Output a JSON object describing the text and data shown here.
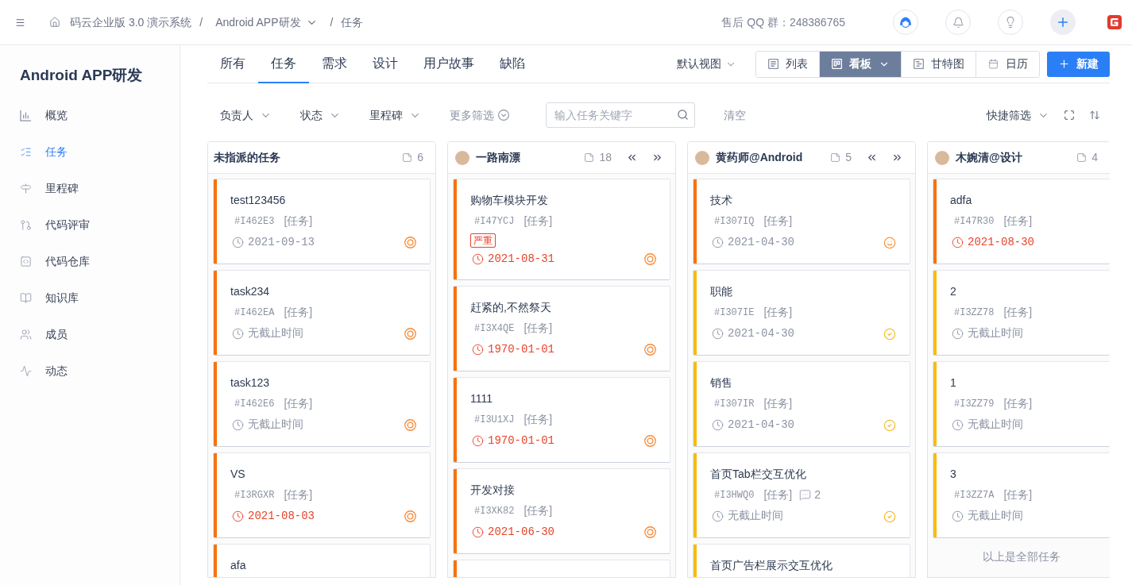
{
  "top_bar": {
    "breadcrumb": [
      {
        "kind": "home",
        "text": "码云企业版 3.0 演示系统"
      },
      {
        "kind": "separator",
        "text": "/"
      },
      {
        "kind": "dropdown",
        "text": "Android APP研发"
      },
      {
        "kind": "separator",
        "text": "/"
      },
      {
        "kind": "current",
        "text": "任务"
      }
    ],
    "support_group": "售后 QQ 群：248386765"
  },
  "sidebar": {
    "title": "Android APP研发",
    "items": [
      {
        "label": "概览",
        "selected": false
      },
      {
        "label": "任务",
        "selected": true
      },
      {
        "label": "里程碑",
        "selected": false
      },
      {
        "label": "代码评审",
        "selected": false
      },
      {
        "label": "代码仓库",
        "selected": false
      },
      {
        "label": "知识库",
        "selected": false
      },
      {
        "label": "成员",
        "selected": false
      },
      {
        "label": "动态",
        "selected": false
      }
    ]
  },
  "tabs": [
    {
      "label": "所有",
      "selected": false
    },
    {
      "label": "任务",
      "selected": true
    },
    {
      "label": "需求",
      "selected": false
    },
    {
      "label": "设计",
      "selected": false
    },
    {
      "label": "用户故事",
      "selected": false
    },
    {
      "label": "缺陷",
      "selected": false
    }
  ],
  "view_picker": {
    "label": "默认视图"
  },
  "view_modes": [
    {
      "label": "列表",
      "selected": false
    },
    {
      "label": "看板",
      "selected": true
    },
    {
      "label": "甘特图",
      "selected": false
    },
    {
      "label": "日历",
      "selected": false
    }
  ],
  "new_button": {
    "label": "新建"
  },
  "filters": [
    {
      "label": "负责人",
      "kind": "dropdown"
    },
    {
      "label": "状态",
      "kind": "dropdown"
    },
    {
      "label": "里程碑",
      "kind": "dropdown"
    },
    {
      "label": "更多筛选",
      "kind": "more"
    }
  ],
  "search": {
    "placeholder": "输入任务关键字"
  },
  "clear_button": {
    "label": "清空"
  },
  "quick_filter": {
    "label": "快捷筛选"
  },
  "columns": [
    {
      "kind": "unassigned",
      "title": "未指派的任务",
      "count": "6",
      "arrows": false,
      "cards": [
        {
          "title": "test123456",
          "number": "#I462E3",
          "type": "[任务]",
          "due": "2021-09-13",
          "overdue": false,
          "color": "#f7720f",
          "status": {
            "kind": "ring"
          }
        },
        {
          "title": "task234",
          "number": "#I462EA",
          "type": "[任务]",
          "due": "无截止时间",
          "overdue": false,
          "color": "#f7720f",
          "status": {
            "kind": "ring"
          }
        },
        {
          "title": "task123",
          "number": "#I462E6",
          "type": "[任务]",
          "due": "无截止时间",
          "overdue": false,
          "color": "#f7720f",
          "status": {
            "kind": "ring"
          }
        },
        {
          "title": "VS",
          "number": "#I3RGXR",
          "type": "[任务]",
          "due": "2021-08-03",
          "overdue": true,
          "color": "#f7720f",
          "status": {
            "kind": "ring"
          }
        },
        {
          "title": "afa",
          "color": "#f7720f"
        }
      ]
    },
    {
      "kind": "assignee",
      "title": "一路南漂",
      "count": "18",
      "arrows": true,
      "cards": [
        {
          "title": "购物车模块开发",
          "number": "#I47YCJ",
          "type": "[任务]",
          "tags": [
            "严重"
          ],
          "due": "2021-08-31",
          "overdue": true,
          "color": "#f7720f",
          "status": {
            "kind": "ring"
          }
        },
        {
          "title": "赶紧的,不然祭天",
          "number": "#I3X4QE",
          "type": "[任务]",
          "due": "1970-01-01",
          "overdue": true,
          "color": "#f7720f",
          "status": {
            "kind": "ring"
          }
        },
        {
          "title": "1111",
          "number": "#I3U1XJ",
          "type": "[任务]",
          "due": "1970-01-01",
          "overdue": true,
          "color": "#f7720f",
          "status": {
            "kind": "ring"
          }
        },
        {
          "title": "开发对接",
          "number": "#I3XK82",
          "type": "[任务]",
          "due": "2021-06-30",
          "overdue": true,
          "color": "#f7720f",
          "status": {
            "kind": "ring"
          }
        },
        {
          "color": "#f7720f"
        }
      ]
    },
    {
      "kind": "assignee",
      "title": "黄药师@Android",
      "count": "5",
      "arrows": true,
      "cards": [
        {
          "title": "技术",
          "number": "#I307IQ",
          "type": "[任务]",
          "due": "2021-04-30",
          "overdue": false,
          "color": "#f7720f",
          "status": {
            "kind": "smile"
          }
        },
        {
          "title": "职能",
          "number": "#I307IE",
          "type": "[任务]",
          "due": "2021-04-30",
          "overdue": false,
          "color": "#f8bb15",
          "status": {
            "kind": "check"
          }
        },
        {
          "title": "销售",
          "number": "#I307IR",
          "type": "[任务]",
          "due": "2021-04-30",
          "overdue": false,
          "color": "#f8bb15",
          "status": {
            "kind": "check"
          }
        },
        {
          "title": "首页Tab栏交互优化",
          "number": "#I3HWQ0",
          "type": "[任务]",
          "comments": "2",
          "due": "无截止时间",
          "overdue": false,
          "color": "#f8bb15",
          "status": {
            "kind": "check"
          }
        },
        {
          "title": "首页广告栏展示交互优化",
          "color": "#f8bb15"
        }
      ]
    },
    {
      "kind": "assignee",
      "title": "木婉清@设计",
      "count": "4",
      "arrows": false,
      "cards": [
        {
          "title": "adfa",
          "number": "#I47R30",
          "type": "[任务]",
          "due": "2021-08-30",
          "overdue": true,
          "color": "#f7720f"
        },
        {
          "title": "2",
          "number": "#I3ZZ78",
          "type": "[任务]",
          "due": "无截止时间",
          "overdue": false,
          "color": "#f8bb15"
        },
        {
          "title": "1",
          "number": "#I3ZZ79",
          "type": "[任务]",
          "due": "无截止时间",
          "overdue": false,
          "color": "#f8bb15"
        },
        {
          "title": "3",
          "number": "#I3ZZ7A",
          "type": "[任务]",
          "due": "无截止时间",
          "overdue": false,
          "color": "#f8bb15"
        }
      ],
      "footer": "以上是全部任务"
    }
  ]
}
